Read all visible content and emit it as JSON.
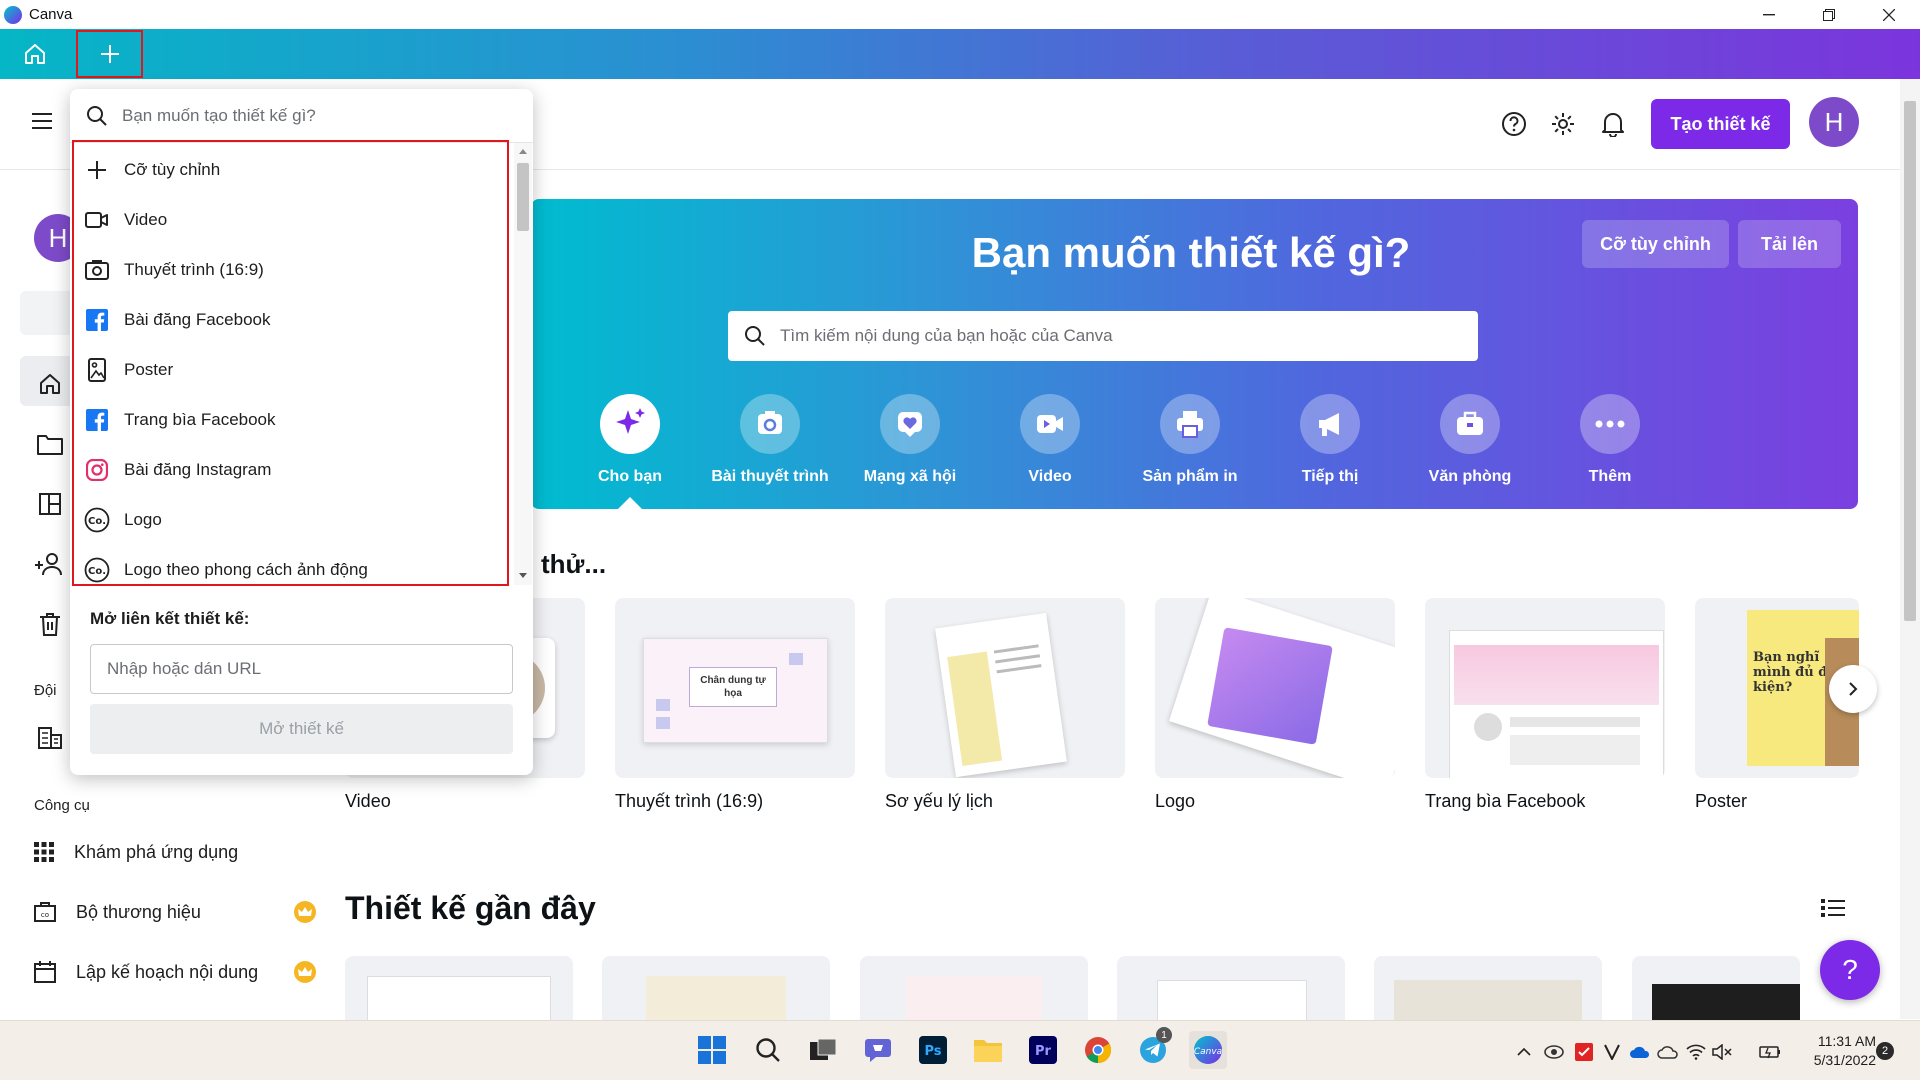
{
  "window": {
    "title": "Canva"
  },
  "header": {
    "create_label": "Tạo thiết kế",
    "avatar_initial": "H"
  },
  "sidebar": {
    "avatar_initial": "H",
    "team_label": "Đội",
    "tools_label": "Công cụ",
    "tools": [
      {
        "label": "Khám phá ứng dụng",
        "icon": "grid-icon"
      },
      {
        "label": "Bộ thương hiệu",
        "icon": "brand-kit-icon",
        "premium": true
      },
      {
        "label": "Lập kế hoạch nội dung",
        "icon": "calendar-icon",
        "premium": true
      }
    ]
  },
  "hero": {
    "title": "Bạn muốn thiết kế gì?",
    "custom_size_label": "Cỡ tùy chỉnh",
    "upload_label": "Tải lên",
    "search_placeholder": "Tìm kiếm nội dung của bạn hoặc của Canva",
    "categories": [
      {
        "label": "Cho bạn",
        "icon": "sparkle-icon"
      },
      {
        "label": "Bài thuyết trình",
        "icon": "presentation-icon"
      },
      {
        "label": "Mạng xã hội",
        "icon": "heart-icon"
      },
      {
        "label": "Video",
        "icon": "video-camera-icon"
      },
      {
        "label": "Sản phẩm in",
        "icon": "printer-icon"
      },
      {
        "label": "Tiếp thị",
        "icon": "megaphone-icon"
      },
      {
        "label": "Văn phòng",
        "icon": "briefcase-icon"
      },
      {
        "label": "Thêm",
        "icon": "more-icon"
      }
    ]
  },
  "try_section": {
    "title_visible": "thử...",
    "cards": [
      {
        "label": "Video"
      },
      {
        "label": "Thuyết trình (16:9)",
        "thumb_text": "Chân dung tự họa"
      },
      {
        "label": "Sơ yếu lý lịch"
      },
      {
        "label": "Logo"
      },
      {
        "label": "Trang bìa Facebook"
      },
      {
        "label": "Poster",
        "thumb_text": "Bạn nghĩ mình đủ điều kiện?"
      }
    ]
  },
  "recent": {
    "title": "Thiết kế gần đây"
  },
  "dropdown": {
    "search_placeholder": "Bạn muốn tạo thiết kế gì?",
    "items": [
      {
        "label": "Cỡ tùy chỉnh",
        "icon": "plus-icon"
      },
      {
        "label": "Video",
        "icon": "video-icon"
      },
      {
        "label": "Thuyết trình (16:9)",
        "icon": "presentation-icon"
      },
      {
        "label": "Bài đăng Facebook",
        "icon": "facebook-icon"
      },
      {
        "label": "Poster",
        "icon": "poster-icon"
      },
      {
        "label": "Trang bìa Facebook",
        "icon": "facebook-icon"
      },
      {
        "label": "Bài đăng Instagram",
        "icon": "instagram-icon"
      },
      {
        "label": "Logo",
        "icon": "logo-icon"
      },
      {
        "label": "Logo theo phong cách ảnh động",
        "icon": "logo-icon"
      }
    ],
    "link_label": "Mở liên kết thiết kế:",
    "link_placeholder": "Nhập hoặc dán URL",
    "open_label": "Mở thiết kế"
  },
  "taskbar": {
    "time": "11:31 AM",
    "date": "5/31/2022",
    "notification_count": "2",
    "telegram_badge": "1"
  },
  "colors": {
    "accent": "#7d2ae8",
    "highlight": "#e0171d"
  }
}
